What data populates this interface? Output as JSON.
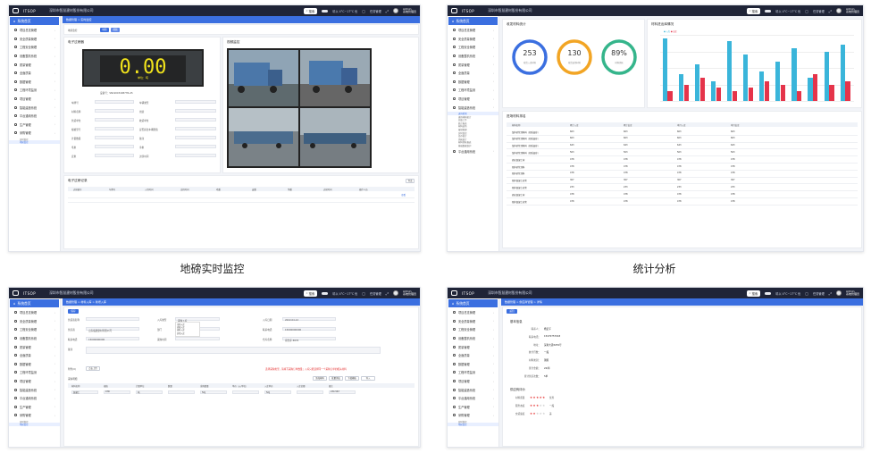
{
  "captions": [
    "地磅实时监控",
    "统计分析",
    "",
    ""
  ],
  "header": {
    "logo": "ITSOP",
    "company": "深圳市智慧建材股份有限公司",
    "search_label": "搜索",
    "weather": "晴以 4°C~17°C  优",
    "link": "任务管理",
    "user_name": "Admin",
    "user_role": "系统管理员"
  },
  "sidebar": {
    "home": "系统首页",
    "items": [
      "项目总览管理",
      "安全质量管理",
      "工程安全管理",
      "设备整机系统",
      "质量管理",
      "全面质量",
      "数据管理",
      "工程环境监测",
      "项目管理",
      "智能建造系统",
      "平台通用系统",
      "生产管理",
      "采购管理"
    ],
    "sub_items": [
      "进场检测",
      "退场材料统计",
      "总账工作",
      "统计报表",
      "材料进场",
      "报销管理",
      "实时监控",
      "库存统计",
      "消耗统计",
      "材料消耗报表",
      "基础数据维护"
    ],
    "active_sub": "地磅监控"
  },
  "panel1": {
    "crumb": "数据管理 > 实时监控",
    "tabs": [
      "地磅",
      "视频"
    ],
    "scale_title": "电子过磅器",
    "scale_value": "0.00",
    "scale_unit": "单位：吨",
    "device_no": "设备号：SN190034087HS-45",
    "left_labels": [
      "车牌号",
      "材料名称",
      "供货单位",
      "规格型号",
      "计量数量",
      "毛重",
      "皮重"
    ],
    "right_labels": [
      "车辆类型",
      "用途",
      "收货单位",
      "是否超出车辆限值",
      "备注",
      "净重",
      "过磅时间"
    ],
    "video_title": "视频监控",
    "records_title": "电子过磅记录",
    "export_label": "导出",
    "table_headers": [
      "过磅编号",
      "车牌号",
      "入场时间",
      "出场时间",
      "毛重",
      "皮重",
      "净重",
      "过磅时间",
      "操作人员"
    ],
    "table_cell": "查看"
  },
  "panel2": {
    "count_title": "收发材料统计",
    "donuts": [
      {
        "value": "253",
        "label": "收货入库材料",
        "color": "#3b6fe0"
      },
      {
        "value": "130",
        "label": "收货进场材料",
        "color": "#f2a524"
      },
      {
        "value": "89%",
        "label": "材料消耗",
        "color": "#35b58b"
      }
    ],
    "bars_title": "材料进出库情况",
    "legend": [
      "● 入库",
      "● 出库"
    ],
    "chart_data": {
      "type": "bar",
      "categories": [
        "1",
        "2",
        "3",
        "4",
        "5",
        "6",
        "7",
        "8",
        "9",
        "10",
        "11",
        "12"
      ],
      "series": [
        {
          "name": "入库",
          "color": "#3ab5da",
          "values": [
            95,
            40,
            55,
            30,
            90,
            70,
            45,
            60,
            80,
            35,
            75,
            85
          ]
        },
        {
          "name": "出库",
          "color": "#e5344a",
          "values": [
            15,
            25,
            35,
            20,
            15,
            20,
            30,
            25,
            15,
            40,
            25,
            30
          ]
        }
      ]
    },
    "table_title": "进场材料排名",
    "table_headers": [
      "材料名称",
      "累计入库",
      "累计出库",
      "本月入库",
      "本月出库"
    ],
    "rows": [
      [
        "湿拌砂浆涂料料（轻质面砂）",
        "603",
        "603",
        "603",
        "603"
      ],
      [
        "湿拌砂浆涂料料（轻质面砂）",
        "603",
        "603",
        "603",
        "603"
      ],
      [
        "湿拌砂浆涂料料（轻质面砂）",
        "643",
        "643",
        "643",
        "643"
      ],
      [
        "湿拌砂浆涂料料（轻质面砂）",
        "503",
        "503",
        "503",
        "503"
      ],
      [
        "商砼混凝土材",
        "478",
        "478",
        "478",
        "478"
      ],
      [
        "预拌砂浆涂料",
        "478",
        "478",
        "478",
        "478"
      ],
      [
        "预拌砂浆涂料",
        "478",
        "478",
        "478",
        "478"
      ],
      [
        "预拌混凝土砂浆",
        "307",
        "307",
        "307",
        "307"
      ],
      [
        "预拌混凝土砂浆",
        "233",
        "233",
        "233",
        "233"
      ],
      [
        "商砼混凝土材",
        "478",
        "478",
        "478",
        "478"
      ],
      [
        "预拌混凝土砂浆",
        "478",
        "478",
        "478",
        "478"
      ]
    ]
  },
  "panel3": {
    "crumb": "数据管理 > 材料入库 > 新增入库",
    "save_label": "保存",
    "labels": [
      "供货商名称",
      "供应商",
      "联系电话",
      "备注"
    ],
    "mid_labels": [
      "入库类型",
      "部门",
      "采购时间"
    ],
    "right_labels": [
      "入库日期",
      "联系电话",
      "仓库名称"
    ],
    "supplier_value": "山东临建建材有限公司",
    "phone_value": "15000000000",
    "entry_type": "采购入库",
    "options": [
      "采购入库",
      "调拨入库",
      "退料入库",
      "其他入库"
    ],
    "date_value": "2022-04-12",
    "phone2": "15000000000",
    "warehouse": "南仓库 8878",
    "warning": "选择采购类型，请填写采购订单数量；入库只能选择同一个采购订单的相关材料",
    "attach_label": "附件(0)",
    "upload": "点击上传",
    "detail_title": "采购明细",
    "detail_buttons": [
      "添加材料",
      "批量添加",
      "下载模板",
      "导入"
    ],
    "detail_headers": [
      "材料名称",
      "规格",
      "计量单位",
      "数量",
      "采购数量",
      "单价（元/单位）",
      "入库单价",
      "入库金额",
      "备注"
    ],
    "detail_row": [
      "混凝土",
      "47R",
      "吨",
      "",
      "5吨",
      "",
      "5吨",
      "",
      "234.567"
    ]
  },
  "panel4": {
    "crumb": "数据管理 > 供应商管理 > 详情",
    "back_label": "返回",
    "basic_title": "基本信息",
    "info_labels": [
      "联系人：",
      "联系电话：",
      "地址：",
      "统计月数：",
      "材料类别：",
      "累计金额：",
      "累计供应次数："
    ],
    "info_values": [
      "杨定军",
      "15470757018",
      "深圳大道8259号",
      "一般",
      "钢筋",
      "22/年",
      "5单"
    ],
    "rating_title": "供应商评价",
    "ratings": [
      {
        "label": "材料质量",
        "stars": 5,
        "text": "优秀"
      },
      {
        "label": "服务态度",
        "stars": 3,
        "text": "一般"
      },
      {
        "label": "交货速度",
        "stars": 2,
        "text": "差"
      }
    ]
  }
}
